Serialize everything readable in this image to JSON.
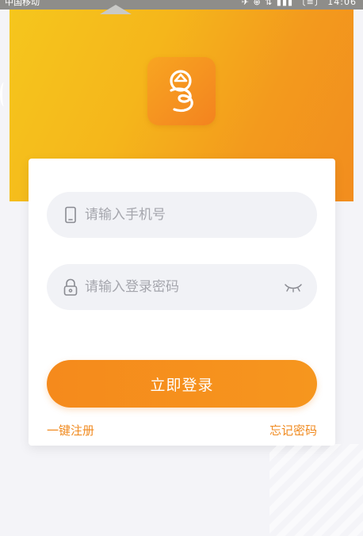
{
  "status_bar": {
    "carrier": "中国移动",
    "right_text": "✈ ⊕ ⇅ ▮▮▮ 〔≡〕 14:06"
  },
  "app_icon": "rain-drop-coin-logo-icon",
  "login_form": {
    "phone_placeholder": "请输入手机号",
    "password_placeholder": "请输入登录密码",
    "phone_icon": "phone-icon",
    "lock_icon": "lock-icon",
    "toggle_icon": "eye-closed-icon",
    "login_label": "立即登录",
    "register_label": "一键注册",
    "forgot_label": "忘记密码"
  },
  "colors": {
    "accent": "#f58a1c",
    "header_start": "#f5c61d",
    "header_end": "#f28d1e",
    "link": "#f08a1f"
  }
}
